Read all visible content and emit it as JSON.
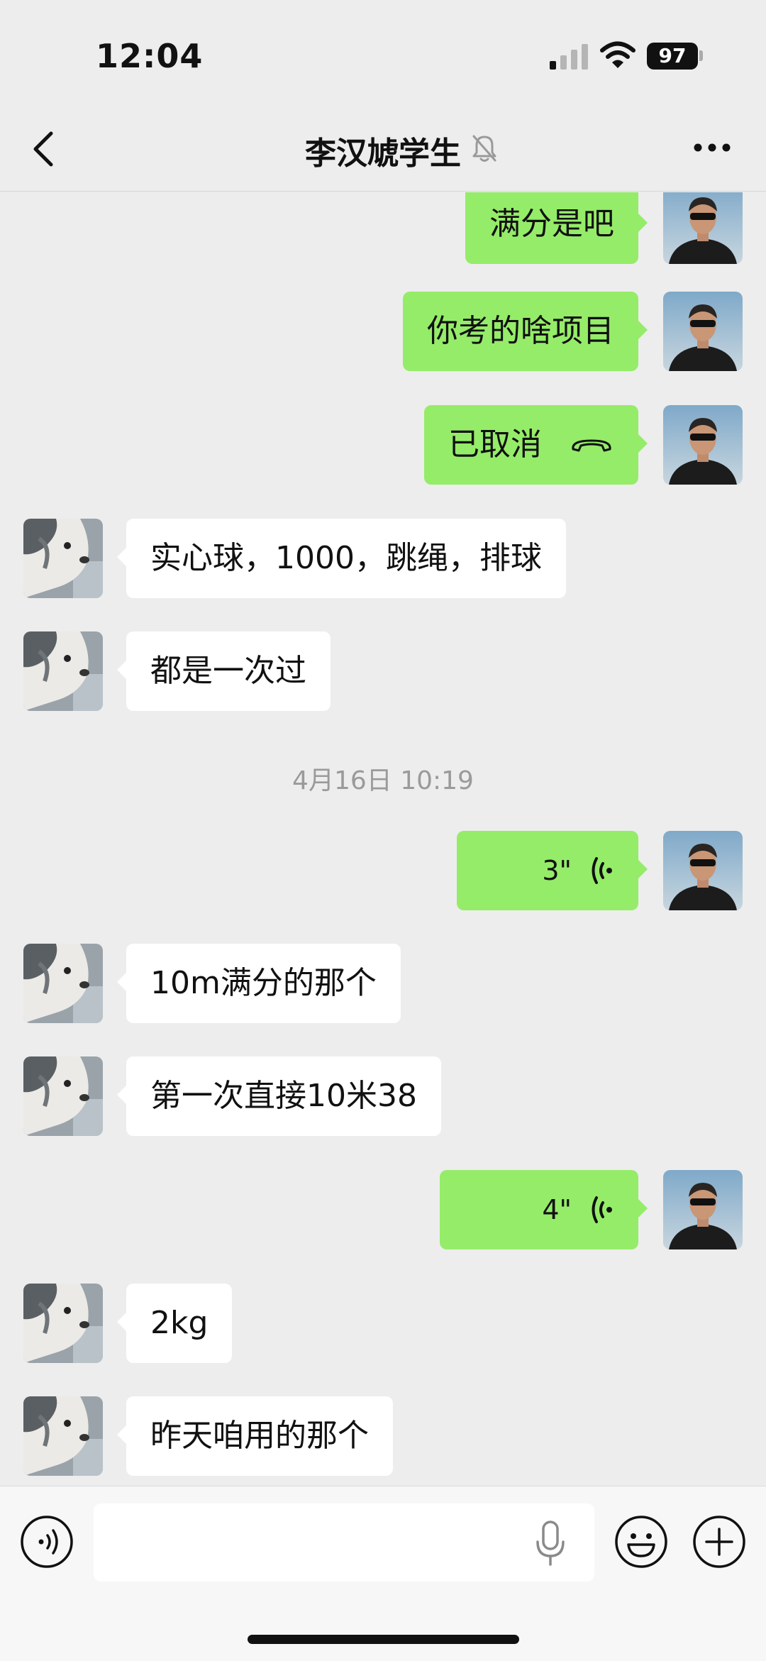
{
  "status_bar": {
    "time": "12:04",
    "battery": "97"
  },
  "header": {
    "title": "李汉虓学生",
    "muted": true
  },
  "messages": [
    {
      "side": "out",
      "type": "text",
      "text": "满分是吧"
    },
    {
      "side": "out",
      "type": "text",
      "text": "你考的啥项目"
    },
    {
      "side": "out",
      "type": "call",
      "text": "已取消"
    },
    {
      "side": "in",
      "type": "text",
      "text": "实心球，1000，跳绳，排球"
    },
    {
      "side": "in",
      "type": "text",
      "text": "都是一次过"
    },
    {
      "type": "time",
      "text": "4月16日 10:19"
    },
    {
      "side": "out",
      "type": "voice",
      "duration": "3\""
    },
    {
      "side": "in",
      "type": "text",
      "text": "10m满分的那个"
    },
    {
      "side": "in",
      "type": "text",
      "text": "第一次直接10米38"
    },
    {
      "side": "out",
      "type": "voice",
      "duration": "4\""
    },
    {
      "side": "in",
      "type": "text",
      "text": "2kg"
    },
    {
      "side": "in",
      "type": "text",
      "text": "昨天咱用的那个"
    }
  ],
  "colors": {
    "sent_bubble": "#95ec69",
    "received_bubble": "#ffffff",
    "background": "#ededed"
  },
  "icons": [
    "back-icon",
    "mute-icon",
    "more-icon",
    "hang-up-icon",
    "voice-wave-icon",
    "mic-icon",
    "emoji-icon",
    "plus-icon"
  ]
}
